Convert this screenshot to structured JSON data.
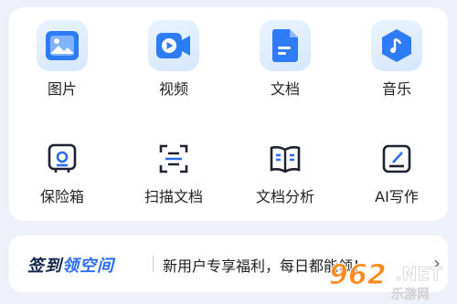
{
  "primary_features": [
    {
      "label": "图片",
      "icon": "image-icon"
    },
    {
      "label": "视频",
      "icon": "video-icon"
    },
    {
      "label": "文档",
      "icon": "document-icon"
    },
    {
      "label": "音乐",
      "icon": "music-icon"
    }
  ],
  "secondary_features": [
    {
      "label": "保险箱",
      "icon": "safe-icon"
    },
    {
      "label": "扫描文档",
      "icon": "scan-icon"
    },
    {
      "label": "文档分析",
      "icon": "book-icon"
    },
    {
      "label": "AI写作",
      "icon": "edit-icon"
    }
  ],
  "banner": {
    "title_part1": "签到",
    "title_part2": "领空间",
    "text": "新用户专享福利，每日都能领！",
    "chevron": "›"
  },
  "watermark": {
    "logo": "962",
    "net": ".NET",
    "sub": "乐游网"
  },
  "colors": {
    "accent": "#2b6cf6",
    "tile_bg": "#dbe9ff",
    "text": "#222222"
  }
}
